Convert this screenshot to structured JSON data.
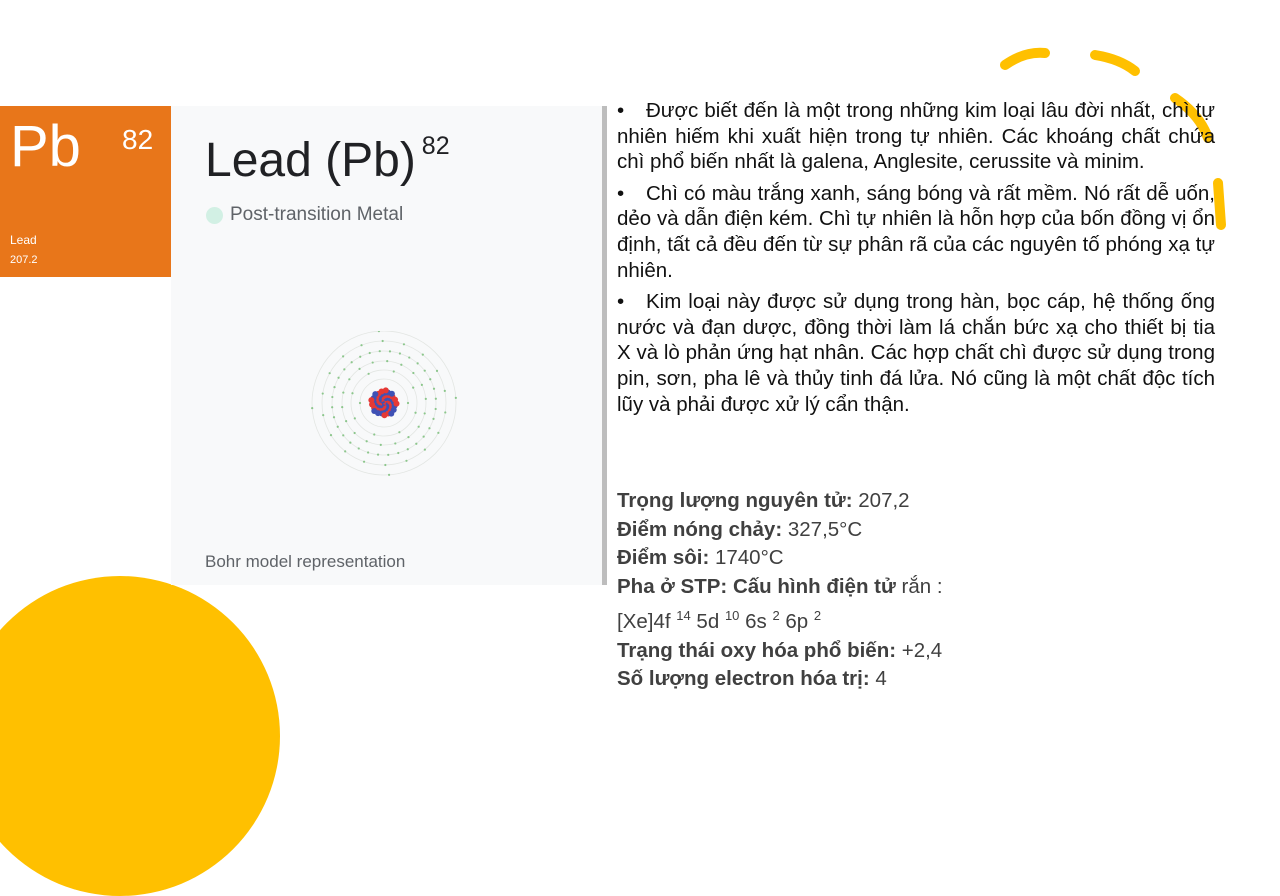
{
  "tile": {
    "symbol": "Pb",
    "number": "82",
    "name": "Lead",
    "weight": "207.2",
    "color": "#E8761A"
  },
  "card": {
    "title": "Lead (Pb)",
    "title_number": "82",
    "category": "Post-transition Metal",
    "category_color": "#D2F0E4",
    "caption": "Bohr model representation"
  },
  "bullets": [
    "Được biết đến là một trong những kim loại lâu đời nhất, chì tự nhiên hiếm khi xuất hiện trong tự nhiên. Các khoáng chất chứa chì phổ biến nhất là galena, Anglesite, cerussite và minim.",
    "Chì có màu trắng xanh, sáng bóng và rất mềm. Nó rất dễ uốn, dẻo và dẫn điện kém. Chì tự nhiên là hỗn hợp của bốn đồng vị ổn định, tất cả đều đến từ sự phân rã của các nguyên tố phóng xạ tự nhiên.",
    "Kim loại này được sử dụng trong hàn, bọc cáp, hệ thống ống nước và đạn dược, đồng thời làm lá chắn bức xạ cho thiết bị tia X và lò phản ứng hạt nhân. Các hợp chất chì được sử dụng trong pin, sơn, pha lê và thủy tinh đá lửa. Nó cũng là một chất độc tích lũy và phải được xử lý cẩn thận."
  ],
  "bullet_marker": "•",
  "props": {
    "atomic_weight_label": "Trọng lượng nguyên tử:",
    "atomic_weight_value": " 207,2",
    "melting_label": "Điểm nóng chảy:",
    "melting_value": " 327,5°C",
    "boiling_label": "Điểm sôi:",
    "boiling_value": " 1740°C",
    "phase_label": "Pha ở STP: Cấu hình điện tử",
    "phase_value": " rắn :",
    "config": {
      "p1": "[Xe]4f ",
      "s1": "14",
      "p2": " 5d ",
      "s2": "10",
      "p3": " 6s ",
      "s3": "2",
      "p4": " 6p ",
      "s4": "2"
    },
    "oxidation_label": "Trạng thái oxy hóa phổ biến:",
    "oxidation_value": " +2,4",
    "valence_label": "Số lượng electron hóa trị:",
    "valence_value": " 4"
  },
  "decor": {
    "accent": "#FFC000"
  }
}
